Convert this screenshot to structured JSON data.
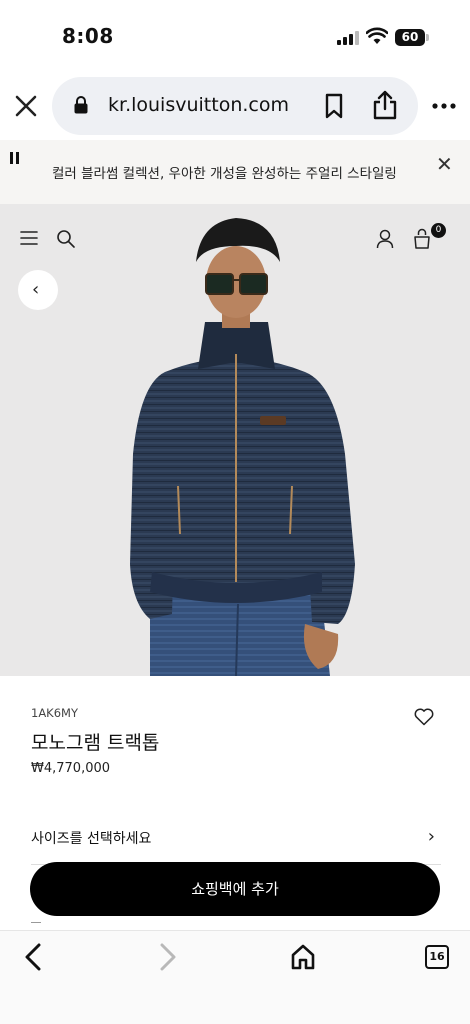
{
  "status_bar": {
    "time": "8:08",
    "battery_level": "60",
    "icons": [
      "signal-icon",
      "wifi-icon",
      "battery-icon"
    ]
  },
  "browser": {
    "url": "kr.louisvuitton.com",
    "icons": [
      "close-icon",
      "lock-icon",
      "bookmark-icon",
      "share-icon",
      "more-icon"
    ]
  },
  "banner": {
    "text": "컬러 블라썸 컬렉션, 우아한 개성을 완성하는 주얼리 스타일링",
    "icons": [
      "pause-icon",
      "close-icon"
    ]
  },
  "header": {
    "bag_count": "0",
    "icons": [
      "menu-icon",
      "search-icon",
      "account-icon",
      "shopping-bag-icon",
      "back-arrow-icon"
    ]
  },
  "product": {
    "sku": "1AK6MY",
    "name": "모노그램 트랙톱",
    "price": "₩4,770,000",
    "size_prompt": "사이즈를 선택하세요",
    "add_to_bag": "쇼핑백에 추가",
    "icons": [
      "heart-icon",
      "chevron-right-icon"
    ]
  },
  "toolbar": {
    "tab_count": "16",
    "icons": [
      "back-icon",
      "forward-icon",
      "home-icon",
      "tabs-icon"
    ]
  },
  "colors": {
    "primary_button": "#000000",
    "banner_bg": "#f6f5f3",
    "hero_bg": "#e9e8e8",
    "url_pill_bg": "#eef0f4",
    "disabled_icon": "#b8b8b8"
  }
}
